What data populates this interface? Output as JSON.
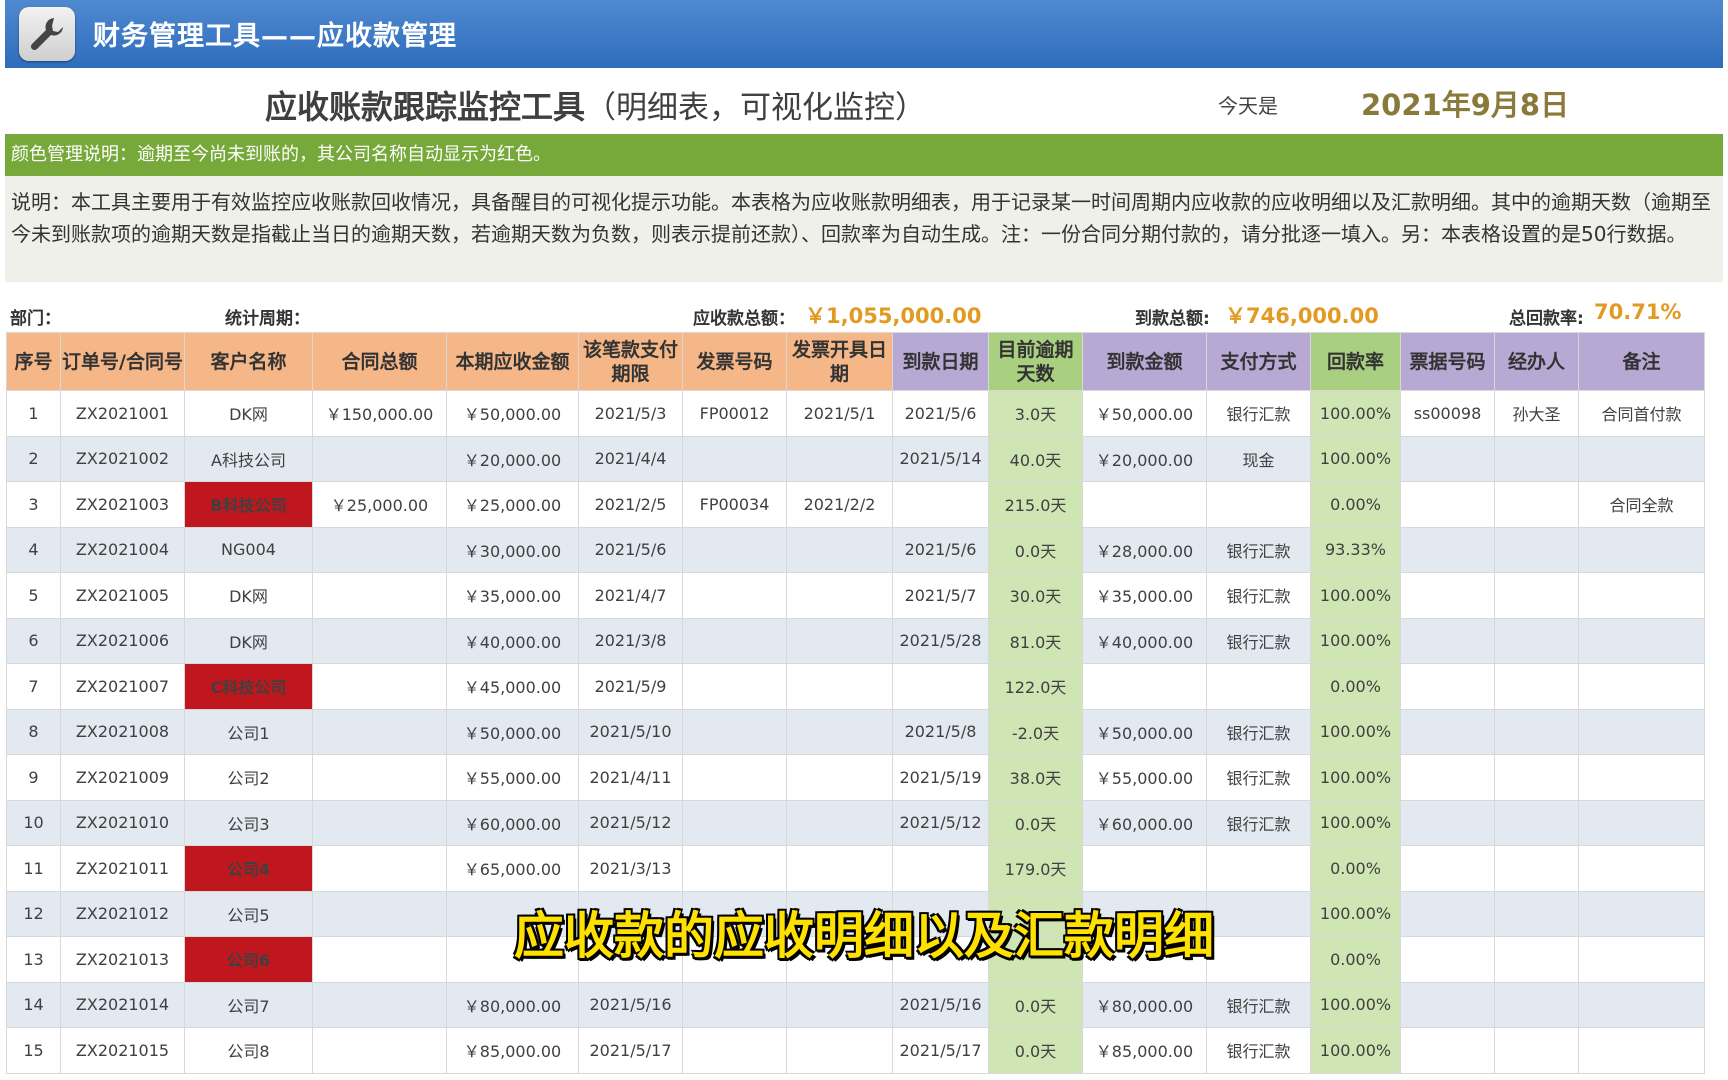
{
  "app": {
    "title": "财务管理工具——应收款管理",
    "icon": "wrench-icon"
  },
  "header": {
    "title": "应收账款跟踪监控工具",
    "subtitle": "（明细表，可视化监控）",
    "today_label": "今天是",
    "today_date": "2021年9月8日"
  },
  "color_note": "颜色管理说明：逾期至今尚未到账的，其公司名称自动显示为红色。",
  "explanation": "说明：本工具主要用于有效监控应收账款回收情况，具备醒目的可视化提示功能。本表格为应收账款明细表，用于记录某一时间周期内应收款的应收明细以及汇款明细。其中的逾期天数（逾期至今未到账款项的逾期天数是指截止当日的逾期天数，若逾期天数为负数，则表示提前还款）、回款率为自动生成。注：一份合同分期付款的，请分批逐一填入。另：本表格设置的是50行数据。",
  "summary": {
    "dept_label": "部门：",
    "period_label": "统计周期：",
    "receivable_label": "应收款总额：",
    "receivable_value": "￥1,055,000.00",
    "received_label": "到款总额:",
    "received_value": "￥746,000.00",
    "rate_label": "总回款率:",
    "rate_value": "70.71%"
  },
  "colors": {
    "titlebar": "#2f6cbc",
    "header_orange": "#f6b788",
    "header_purple": "#b7a8d4",
    "header_green": "#a9cf80",
    "overdue_red": "#c0161d",
    "note_green": "#76a83a"
  },
  "columns": [
    "序号",
    "订单号/合同号",
    "客户名称",
    "合同总额",
    "本期应收金额",
    "该笔款支付期限",
    "发票号码",
    "发票开具日期",
    "到款日期",
    "目前逾期天数",
    "到款金额",
    "支付方式",
    "回款率",
    "票据号码",
    "经办人",
    "备注"
  ],
  "rows": [
    {
      "no": "1",
      "order": "ZX2021001",
      "customer": "DK网",
      "contract": "￥150,000.00",
      "due_amount": "￥50,000.00",
      "due_date": "2021/5/3",
      "invoice_no": "FP00012",
      "invoice_date": "2021/5/1",
      "paid_date": "2021/5/6",
      "overdue": "3.0天",
      "paid_amount": "￥50,000.00",
      "method": "银行汇款",
      "rate": "100.00%",
      "bill_no": "ss00098",
      "handler": "孙大圣",
      "note": "合同首付款",
      "overdue_flag": false
    },
    {
      "no": "2",
      "order": "ZX2021002",
      "customer": "A科技公司",
      "contract": "",
      "due_amount": "￥20,000.00",
      "due_date": "2021/4/4",
      "invoice_no": "",
      "invoice_date": "",
      "paid_date": "2021/5/14",
      "overdue": "40.0天",
      "paid_amount": "￥20,000.00",
      "method": "现金",
      "rate": "100.00%",
      "bill_no": "",
      "handler": "",
      "note": "",
      "overdue_flag": false
    },
    {
      "no": "3",
      "order": "ZX2021003",
      "customer": "B科技公司",
      "contract": "￥25,000.00",
      "due_amount": "￥25,000.00",
      "due_date": "2021/2/5",
      "invoice_no": "FP00034",
      "invoice_date": "2021/2/2",
      "paid_date": "",
      "overdue": "215.0天",
      "paid_amount": "",
      "method": "",
      "rate": "0.00%",
      "bill_no": "",
      "handler": "",
      "note": "合同全款",
      "overdue_flag": true
    },
    {
      "no": "4",
      "order": "ZX2021004",
      "customer": "NG004",
      "contract": "",
      "due_amount": "￥30,000.00",
      "due_date": "2021/5/6",
      "invoice_no": "",
      "invoice_date": "",
      "paid_date": "2021/5/6",
      "overdue": "0.0天",
      "paid_amount": "￥28,000.00",
      "method": "银行汇款",
      "rate": "93.33%",
      "bill_no": "",
      "handler": "",
      "note": "",
      "overdue_flag": false
    },
    {
      "no": "5",
      "order": "ZX2021005",
      "customer": "DK网",
      "contract": "",
      "due_amount": "￥35,000.00",
      "due_date": "2021/4/7",
      "invoice_no": "",
      "invoice_date": "",
      "paid_date": "2021/5/7",
      "overdue": "30.0天",
      "paid_amount": "￥35,000.00",
      "method": "银行汇款",
      "rate": "100.00%",
      "bill_no": "",
      "handler": "",
      "note": "",
      "overdue_flag": false
    },
    {
      "no": "6",
      "order": "ZX2021006",
      "customer": "DK网",
      "contract": "",
      "due_amount": "￥40,000.00",
      "due_date": "2021/3/8",
      "invoice_no": "",
      "invoice_date": "",
      "paid_date": "2021/5/28",
      "overdue": "81.0天",
      "paid_amount": "￥40,000.00",
      "method": "银行汇款",
      "rate": "100.00%",
      "bill_no": "",
      "handler": "",
      "note": "",
      "overdue_flag": false
    },
    {
      "no": "7",
      "order": "ZX2021007",
      "customer": "C科技公司",
      "contract": "",
      "due_amount": "￥45,000.00",
      "due_date": "2021/5/9",
      "invoice_no": "",
      "invoice_date": "",
      "paid_date": "",
      "overdue": "122.0天",
      "paid_amount": "",
      "method": "",
      "rate": "0.00%",
      "bill_no": "",
      "handler": "",
      "note": "",
      "overdue_flag": true
    },
    {
      "no": "8",
      "order": "ZX2021008",
      "customer": "公司1",
      "contract": "",
      "due_amount": "￥50,000.00",
      "due_date": "2021/5/10",
      "invoice_no": "",
      "invoice_date": "",
      "paid_date": "2021/5/8",
      "overdue": "-2.0天",
      "paid_amount": "￥50,000.00",
      "method": "银行汇款",
      "rate": "100.00%",
      "bill_no": "",
      "handler": "",
      "note": "",
      "overdue_flag": false
    },
    {
      "no": "9",
      "order": "ZX2021009",
      "customer": "公司2",
      "contract": "",
      "due_amount": "￥55,000.00",
      "due_date": "2021/4/11",
      "invoice_no": "",
      "invoice_date": "",
      "paid_date": "2021/5/19",
      "overdue": "38.0天",
      "paid_amount": "￥55,000.00",
      "method": "银行汇款",
      "rate": "100.00%",
      "bill_no": "",
      "handler": "",
      "note": "",
      "overdue_flag": false
    },
    {
      "no": "10",
      "order": "ZX2021010",
      "customer": "公司3",
      "contract": "",
      "due_amount": "￥60,000.00",
      "due_date": "2021/5/12",
      "invoice_no": "",
      "invoice_date": "",
      "paid_date": "2021/5/12",
      "overdue": "0.0天",
      "paid_amount": "￥60,000.00",
      "method": "银行汇款",
      "rate": "100.00%",
      "bill_no": "",
      "handler": "",
      "note": "",
      "overdue_flag": false
    },
    {
      "no": "11",
      "order": "ZX2021011",
      "customer": "公司4",
      "contract": "",
      "due_amount": "￥65,000.00",
      "due_date": "2021/3/13",
      "invoice_no": "",
      "invoice_date": "",
      "paid_date": "",
      "overdue": "179.0天",
      "paid_amount": "",
      "method": "",
      "rate": "0.00%",
      "bill_no": "",
      "handler": "",
      "note": "",
      "overdue_flag": true
    },
    {
      "no": "12",
      "order": "ZX2021012",
      "customer": "公司5",
      "contract": "",
      "due_amount": "",
      "due_date": "",
      "invoice_no": "",
      "invoice_date": "",
      "paid_date": "",
      "overdue": "",
      "paid_amount": "",
      "method": "",
      "rate": "100.00%",
      "bill_no": "",
      "handler": "",
      "note": "",
      "overdue_flag": false
    },
    {
      "no": "13",
      "order": "ZX2021013",
      "customer": "公司6",
      "contract": "",
      "due_amount": "",
      "due_date": "",
      "invoice_no": "",
      "invoice_date": "",
      "paid_date": "",
      "overdue": "",
      "paid_amount": "",
      "method": "",
      "rate": "0.00%",
      "bill_no": "",
      "handler": "",
      "note": "",
      "overdue_flag": true
    },
    {
      "no": "14",
      "order": "ZX2021014",
      "customer": "公司7",
      "contract": "",
      "due_amount": "￥80,000.00",
      "due_date": "2021/5/16",
      "invoice_no": "",
      "invoice_date": "",
      "paid_date": "2021/5/16",
      "overdue": "0.0天",
      "paid_amount": "￥80,000.00",
      "method": "银行汇款",
      "rate": "100.00%",
      "bill_no": "",
      "handler": "",
      "note": "",
      "overdue_flag": false
    },
    {
      "no": "15",
      "order": "ZX2021015",
      "customer": "公司8",
      "contract": "",
      "due_amount": "￥85,000.00",
      "due_date": "2021/5/17",
      "invoice_no": "",
      "invoice_date": "",
      "paid_date": "2021/5/17",
      "overdue": "0.0天",
      "paid_amount": "￥85,000.00",
      "method": "银行汇款",
      "rate": "100.00%",
      "bill_no": "",
      "handler": "",
      "note": "",
      "overdue_flag": false
    }
  ],
  "caption": "应收款的应收明细以及汇款明细"
}
